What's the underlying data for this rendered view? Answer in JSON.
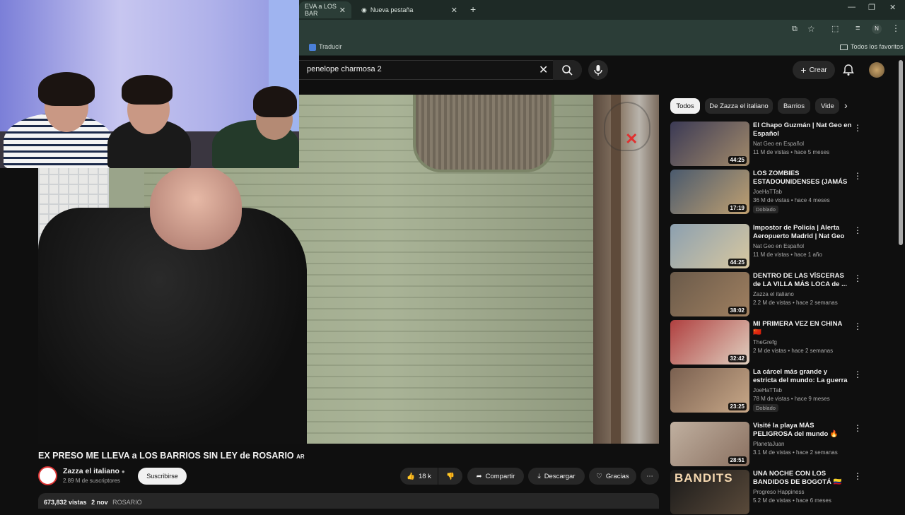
{
  "browser": {
    "tabs": [
      {
        "title": "EVA a LOS BAR",
        "active": true
      },
      {
        "title": "Nueva pestaña",
        "active": false
      }
    ],
    "new_tab": "+",
    "bookmarks": {
      "translate": "Traducir",
      "all_favorites": "Todos los favoritos"
    },
    "profile_initial": "N"
  },
  "youtube": {
    "search_query": "penelope charmosa 2",
    "create_label": "Crear"
  },
  "video": {
    "title": "EX PRESO ME LLEVA a LOS BARRIOS SIN LEY de ROSARIO",
    "title_suffix": "AR",
    "channel": "Zazza el italiano",
    "subscribers": "2.89 M de suscriptores",
    "subscribe_label": "Suscribirse",
    "likes": "18 k",
    "share_label": "Compartir",
    "download_label": "Descargar",
    "thanks_label": "Gracias",
    "views": "673,832 vistas",
    "date": "2 nov",
    "tag": "ROSARIO"
  },
  "chips": [
    "Todos",
    "De Zazza el italiano",
    "Barrios",
    "Vide"
  ],
  "recommendations": [
    {
      "title": "El Chapo Guzmán | Nat Geo en Español",
      "channel": "Nat Geo en Español",
      "meta": "11 M de vistas • hace 5 meses",
      "duration": "44:25",
      "badge": "",
      "colors": [
        "#3b3a55",
        "#a28a6a"
      ]
    },
    {
      "title": "LOS ZOMBIES ESTADOUNIDENSES (JAMÁS ...",
      "channel": "JoeHaTTab",
      "meta": "36 M de vistas • hace 4 meses",
      "duration": "17:19",
      "badge": "Doblado",
      "colors": [
        "#4a5a6e",
        "#c0a070"
      ]
    },
    {
      "title": "Impostor de Policía | Alerta Aeropuerto Madrid | Nat Geo e...",
      "channel": "Nat Geo en Español",
      "meta": "11 M de vistas • hace 1 año",
      "duration": "44:25",
      "badge": "",
      "colors": [
        "#8ca0b0",
        "#d8c8a0"
      ]
    },
    {
      "title": "DENTRO DE LAS VÍSCERAS de LA VILLA MÁS LOCA de ...",
      "channel": "Zazza el italiano",
      "meta": "2.2 M de vistas • hace 2 semanas",
      "duration": "38:02",
      "badge": "",
      "colors": [
        "#6a5a4a",
        "#a08060"
      ]
    },
    {
      "title": "MI PRIMERA VEZ EN CHINA 🇨🇳",
      "channel": "TheGrefg",
      "meta": "2 M de vistas • hace 2 semanas",
      "duration": "32:42",
      "badge": "",
      "colors": [
        "#b04040",
        "#e0d0c0"
      ]
    },
    {
      "title": "La cárcel más grande y estricta del mundo: La guerra de El ...",
      "channel": "JoeHaTTab",
      "meta": "78 M de vistas • hace 9 meses",
      "duration": "23:25",
      "badge": "Doblado",
      "colors": [
        "#7a6050",
        "#c8a888"
      ]
    },
    {
      "title": "Visité la playa MÁS PELIGROSA del mundo 🔥",
      "channel": "PlanetaJuan",
      "meta": "3.1 M de vistas • hace 2 semanas",
      "duration": "28:51",
      "badge": "",
      "colors": [
        "#c0b0a0",
        "#8a7060"
      ]
    },
    {
      "title": "UNA NOCHE CON LOS BANDIDOS DE BOGOTÁ 🇨🇴",
      "channel": "Progreso Happiness",
      "meta": "5.2 M de vistas • hace 6 meses",
      "duration": "",
      "badge": "",
      "thumb_text": "BANDITS",
      "colors": [
        "#1a1a1a",
        "#5a4a3a"
      ]
    }
  ]
}
